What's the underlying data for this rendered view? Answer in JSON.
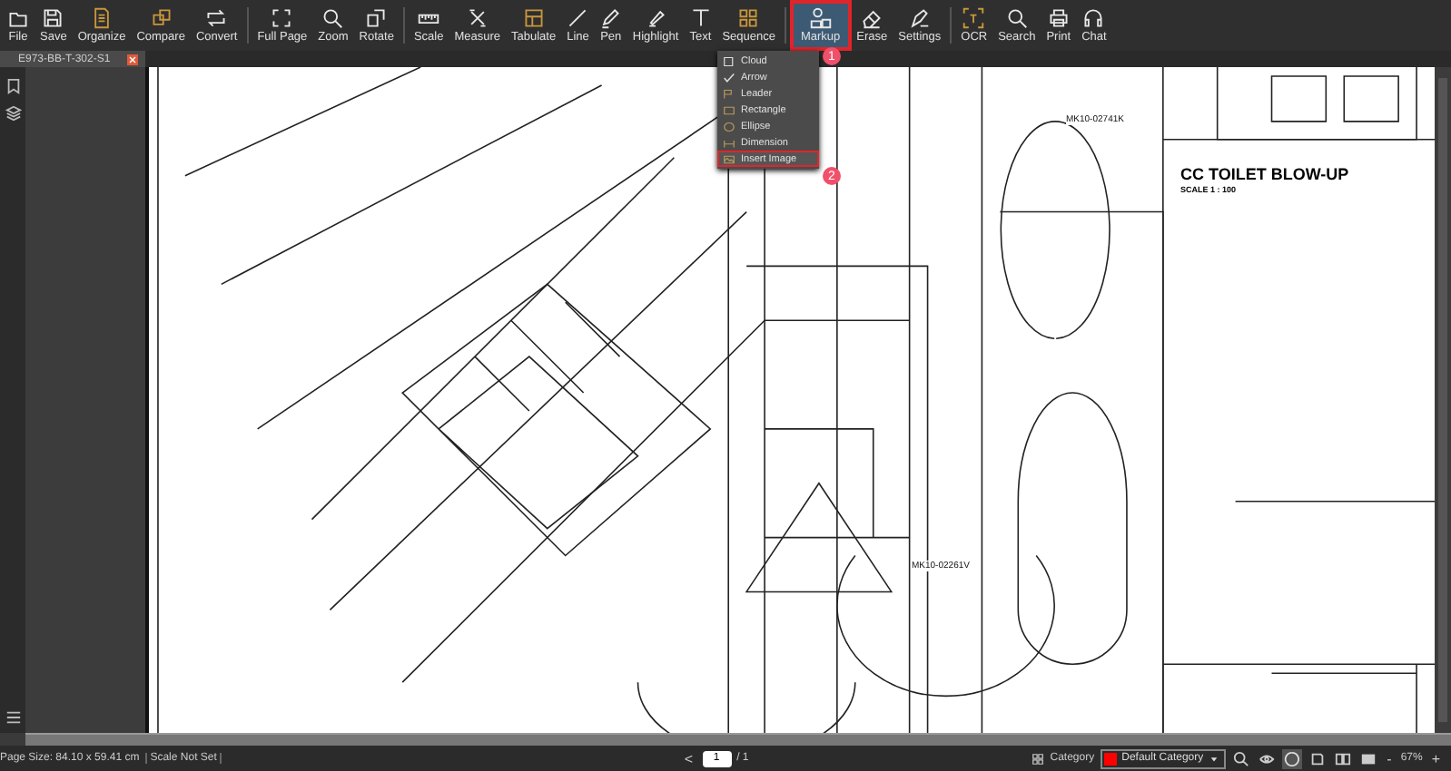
{
  "toolbar": {
    "groups": [
      [
        {
          "label": "File",
          "selected": false
        },
        {
          "label": "Save",
          "selected": false
        },
        {
          "label": "Organize",
          "selected": false
        },
        {
          "label": "Compare",
          "selected": false
        },
        {
          "label": "Convert",
          "selected": false
        }
      ],
      [
        {
          "label": "Full Page",
          "selected": false
        },
        {
          "label": "Zoom",
          "selected": false
        },
        {
          "label": "Rotate",
          "selected": false
        }
      ],
      [
        {
          "label": "Scale",
          "selected": false
        },
        {
          "label": "Measure",
          "selected": false
        },
        {
          "label": "Tabulate",
          "selected": false
        },
        {
          "label": "Line",
          "selected": false
        },
        {
          "label": "Pen",
          "selected": false
        },
        {
          "label": "Highlight",
          "selected": false
        },
        {
          "label": "Text",
          "selected": false
        },
        {
          "label": "Sequence",
          "selected": false
        }
      ],
      [
        {
          "label": "Markup",
          "selected": true
        },
        {
          "label": "Erase",
          "selected": false
        },
        {
          "label": "Settings",
          "selected": false
        }
      ],
      [
        {
          "label": "OCR",
          "selected": false
        },
        {
          "label": "Search",
          "selected": false
        },
        {
          "label": "Print",
          "selected": false
        },
        {
          "label": "Chat",
          "selected": false
        }
      ]
    ]
  },
  "document_tab": {
    "title": "E973-BB-T-302-S1"
  },
  "markup_menu": {
    "items": [
      {
        "label": "Cloud",
        "kind": "cloud",
        "checked": false,
        "selected": false
      },
      {
        "label": "Arrow",
        "checked": true,
        "selected": false
      },
      {
        "label": "Leader",
        "kind": "leader",
        "checked": false,
        "selected": false
      },
      {
        "label": "Rectangle",
        "kind": "rectangle",
        "checked": false,
        "selected": false
      },
      {
        "label": "Ellipse",
        "kind": "ellipse",
        "checked": false,
        "selected": false
      },
      {
        "label": "Dimension",
        "kind": "dimension",
        "checked": false,
        "selected": false
      },
      {
        "label": "Insert Image",
        "kind": "image",
        "checked": false,
        "selected": true
      }
    ]
  },
  "callouts": [
    "1",
    "2"
  ],
  "sheet": {
    "labels": [
      "MK10-02741K",
      "MK10-02261V"
    ],
    "title": "CC TOILET BLOW-UP",
    "scale": "SCALE 1 : 100"
  },
  "status_bar": {
    "page_size": "Page Size: 84.10 x 59.41 cm",
    "scale": "Scale Not Set",
    "prev": "<",
    "page": "1",
    "total": "/ 1",
    "category_label": "Category",
    "category": {
      "name": "Default Category",
      "color": "#ff0000"
    },
    "zoom_out": "-",
    "zoom": "67%",
    "zoom_in": "+"
  }
}
